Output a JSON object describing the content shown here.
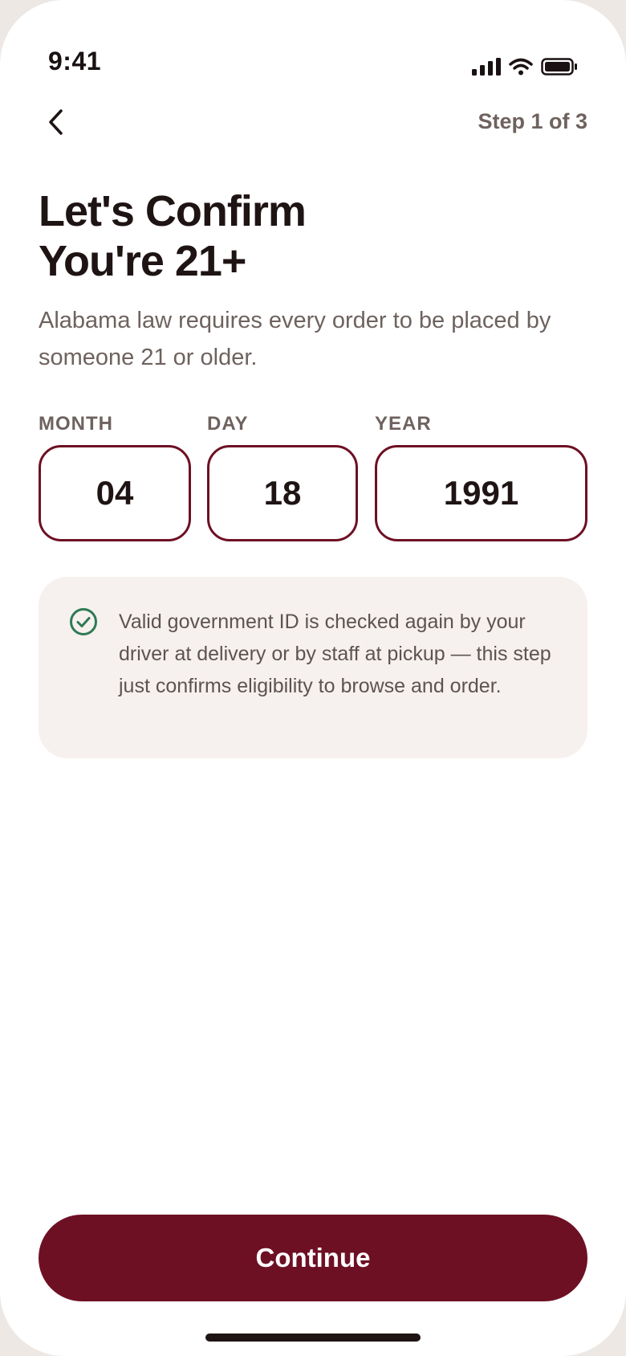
{
  "status_bar": {
    "time": "9:41"
  },
  "nav": {
    "step_label": "Step 1 of 3"
  },
  "heading": {
    "title": "Let's Confirm\nYou're 21+",
    "subtitle": "Alabama law requires every order to be placed by someone 21 or older."
  },
  "dob": {
    "month_label": "MONTH",
    "month_value": "04",
    "day_label": "DAY",
    "day_value": "18",
    "year_label": "YEAR",
    "year_value": "1991"
  },
  "info": {
    "icon": "check-circle-icon",
    "text": "Valid government ID is checked again by your driver at delivery or by staff at pickup — this step just confirms eligibility to browse and order."
  },
  "actions": {
    "continue_label": "Continue"
  },
  "colors": {
    "brand": "#6e1024",
    "success": "#2e7a55",
    "card_bg": "#f6f1ee",
    "muted_text": "#6e625f"
  }
}
